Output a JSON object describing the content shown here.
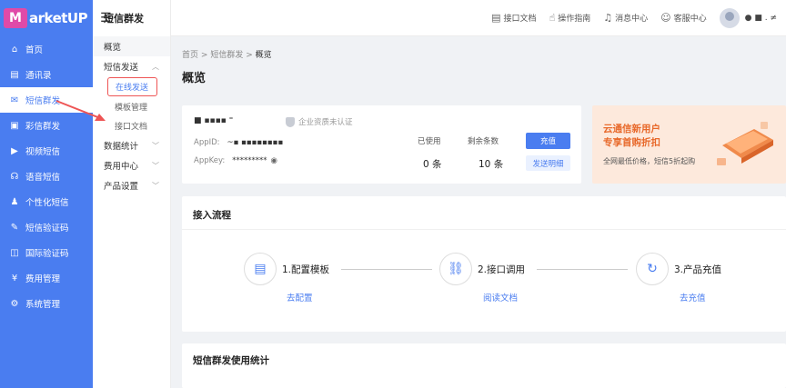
{
  "brand": {
    "mark": "M",
    "text": "arketUP"
  },
  "sidebar": {
    "items": [
      {
        "label": "首页",
        "icon": "home-icon",
        "glyph": "⌂"
      },
      {
        "label": "通讯录",
        "icon": "contacts-icon",
        "glyph": "▤"
      },
      {
        "label": "短信群发",
        "icon": "sms-icon",
        "glyph": "✉"
      },
      {
        "label": "彩信群发",
        "icon": "mms-icon",
        "glyph": "▣"
      },
      {
        "label": "视频短信",
        "icon": "video-sms-icon",
        "glyph": "▶"
      },
      {
        "label": "语音短信",
        "icon": "voice-sms-icon",
        "glyph": "☊"
      },
      {
        "label": "个性化短信",
        "icon": "personalized-sms-icon",
        "glyph": "♟"
      },
      {
        "label": "短信验证码",
        "icon": "verification-code-icon",
        "glyph": "✎"
      },
      {
        "label": "国际验证码",
        "icon": "international-code-icon",
        "glyph": "◫"
      },
      {
        "label": "费用管理",
        "icon": "billing-icon",
        "glyph": "¥"
      },
      {
        "label": "系统管理",
        "icon": "settings-icon",
        "glyph": "⚙"
      }
    ]
  },
  "submenu": {
    "title": "短信群发",
    "overview": "概览",
    "send_group": "短信发送",
    "send_children": [
      "在线发送",
      "模板管理",
      "接口文档"
    ],
    "stats": "数据统计",
    "billing": "费用中心",
    "product_settings": "产品设置"
  },
  "header": {
    "api_docs": "接口文档",
    "guide": "操作指南",
    "messages": "消息中心",
    "support": "客服中心",
    "username": "● ■ . ≠"
  },
  "breadcrumb": {
    "home": "首页",
    "sep": ">",
    "section": "短信群发",
    "current": "概览"
  },
  "page_title": "概览",
  "account": {
    "name": "■  ▪▪▪▪  ⁼",
    "cert_status": "企业资质未认证",
    "appid_label": "AppID:",
    "appid_value": "~▪  ▪▪▪▪▪▪▪▪",
    "appkey_label": "AppKey:",
    "appkey_value": "*********",
    "used_label": "已使用",
    "used_value": "0 条",
    "remaining_label": "剩余条数",
    "remaining_value": "10 条",
    "recharge_btn": "充值",
    "detail_btn": "发送明细"
  },
  "promo": {
    "line1": "云通信新用户",
    "line2": "专享首购折扣",
    "sub": "全网最低价格，短信5折起购"
  },
  "flow": {
    "title": "接入流程",
    "steps": [
      {
        "label": "1.配置模板",
        "link": "去配置",
        "icon": "document-icon",
        "glyph": "▤"
      },
      {
        "label": "2.接口调用",
        "link": "阅读文档",
        "icon": "link-icon",
        "glyph": "⛓"
      },
      {
        "label": "3.产品充值",
        "link": "去充值",
        "icon": "recharge-icon",
        "glyph": "↻"
      }
    ]
  },
  "stats_section": {
    "title": "短信群发使用统计"
  },
  "colors": {
    "primary": "#4a7df0",
    "promo_text": "#e8692b",
    "promo_bg": "#fde9dc",
    "annotation": "#e55"
  }
}
